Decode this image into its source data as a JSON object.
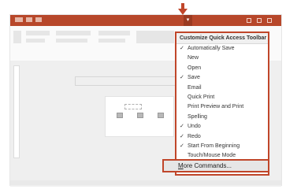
{
  "menu": {
    "header": "Customize Quick Access Toolbar",
    "items": [
      {
        "label": "Automatically Save",
        "checked": true
      },
      {
        "label": "New",
        "checked": false
      },
      {
        "label": "Open",
        "checked": false
      },
      {
        "label": "Save",
        "checked": true
      },
      {
        "label": "Email",
        "checked": false
      },
      {
        "label": "Quick Print",
        "checked": false
      },
      {
        "label": "Print Preview and Print",
        "checked": false
      },
      {
        "label": "Spelling",
        "checked": false
      },
      {
        "label": "Undo",
        "checked": true
      },
      {
        "label": "Redo",
        "checked": true
      },
      {
        "label": "Start From Beginning",
        "checked": true
      },
      {
        "label": "Touch/Mouse Mode",
        "checked": false
      }
    ],
    "more_commands": {
      "accel": "M",
      "rest": "ore Commands..."
    }
  },
  "colors": {
    "accent": "#b7472a",
    "highlight": "#c0462a"
  },
  "icons": {
    "arrow": "down-arrow-icon",
    "dropdown": "chevron-down-icon",
    "check": "check-icon"
  }
}
